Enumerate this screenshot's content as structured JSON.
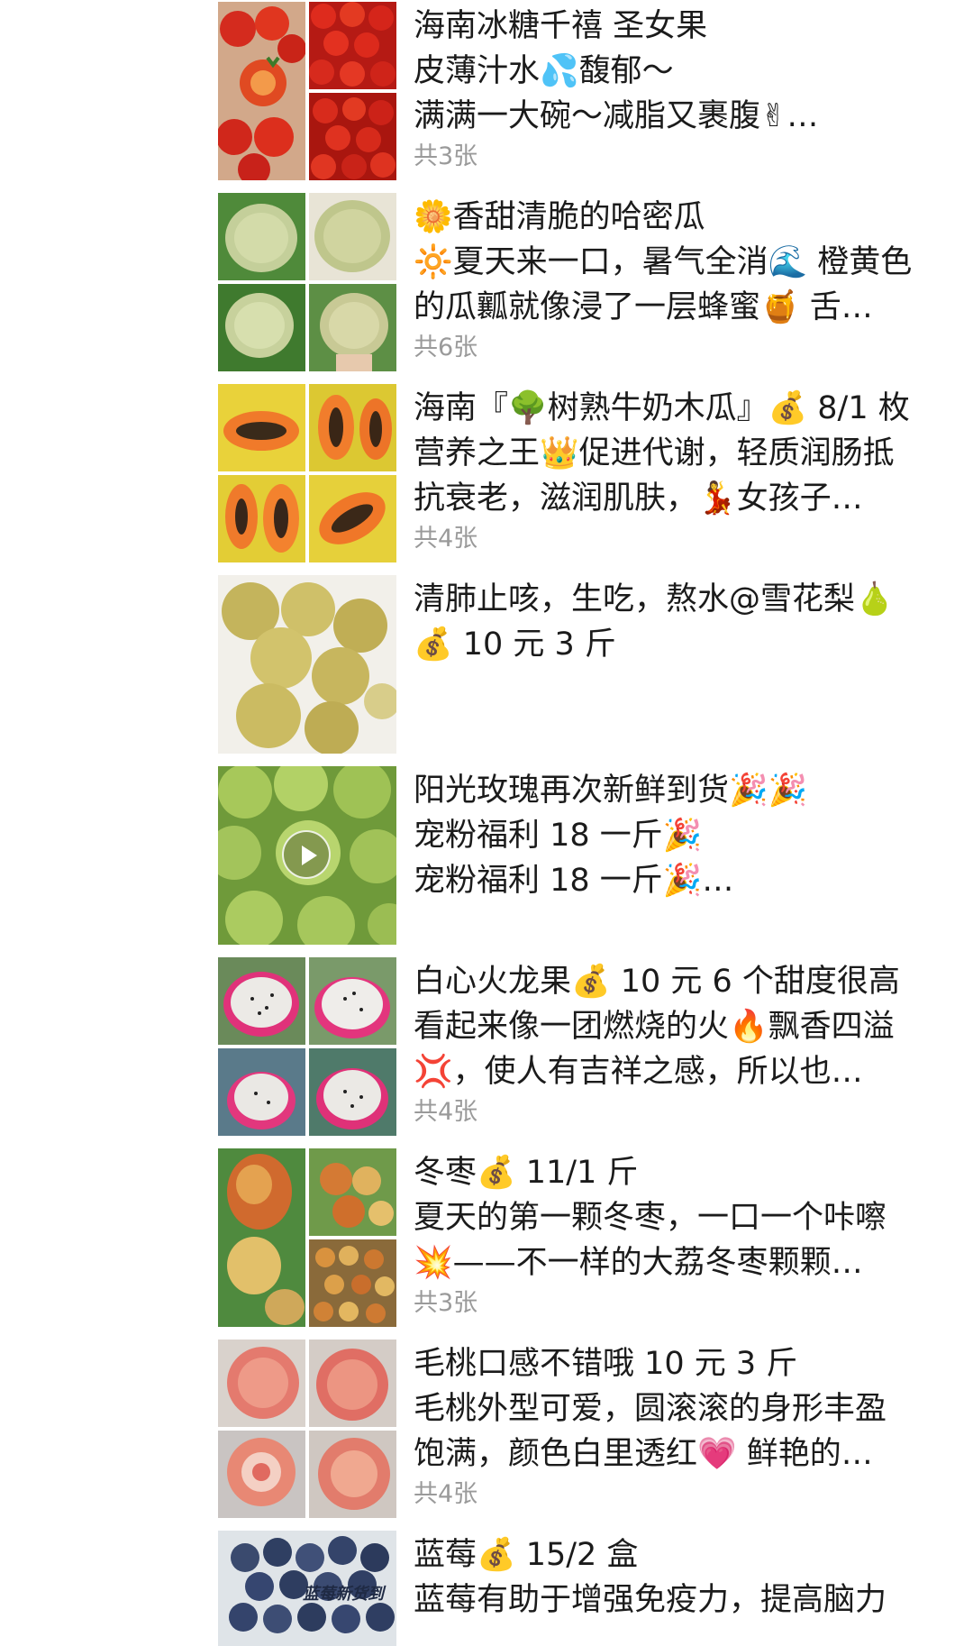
{
  "posts": [
    {
      "lines": [
        "海南冰糖千禧 圣女果",
        "皮薄汁水💦馥郁～",
        "满满一大碗～减脂又裹腹✌…"
      ],
      "count": "共3张"
    },
    {
      "lines": [
        "🌼香甜清脆的哈密瓜",
        "🔆夏天来一口，暑气全消🌊 橙黄色",
        "的瓜瓤就像浸了一层蜂蜜🍯 舌…"
      ],
      "count": "共6张"
    },
    {
      "lines": [
        "海南『🌳树熟牛奶木瓜』💰 8/1 枚",
        "营养之王👑促进代谢，轻质润肠抵",
        "抗衰老，滋润肌肤，💃女孩子…"
      ],
      "count": "共4张"
    },
    {
      "lines": [
        "清肺止咳，生吃，熬水@雪花梨🍐",
        "💰 10 元 3 斤"
      ],
      "count": ""
    },
    {
      "lines": [
        "阳光玫瑰再次新鲜到货🎉🎉",
        "宠粉福利 18 一斤🎉",
        "宠粉福利 18 一斤🎉…"
      ],
      "count": "",
      "is_video": true
    },
    {
      "lines": [
        "白心火龙果💰 10 元 6 个甜度很高",
        "看起来像一团燃烧的火🔥飘香四溢",
        "💢，使人有吉祥之感，所以也…"
      ],
      "count": "共4张"
    },
    {
      "lines": [
        "冬枣💰 11/1 斤",
        "夏天的第一颗冬枣，一口一个咔嚓",
        "💥——不一样的大荔冬枣颗颗…"
      ],
      "count": "共3张"
    },
    {
      "lines": [
        "毛桃口感不错哦 10 元 3 斤",
        "毛桃外型可爱，圆滚滚的身形丰盈",
        "饱满，颜色白里透红💗 鲜艳的…"
      ],
      "count": "共4张"
    },
    {
      "lines": [
        "蓝莓💰 15/2 盒",
        "蓝莓有助于增强免疫力，提高脑力"
      ],
      "count": "",
      "thumb_caption": "蓝莓新货到"
    }
  ]
}
